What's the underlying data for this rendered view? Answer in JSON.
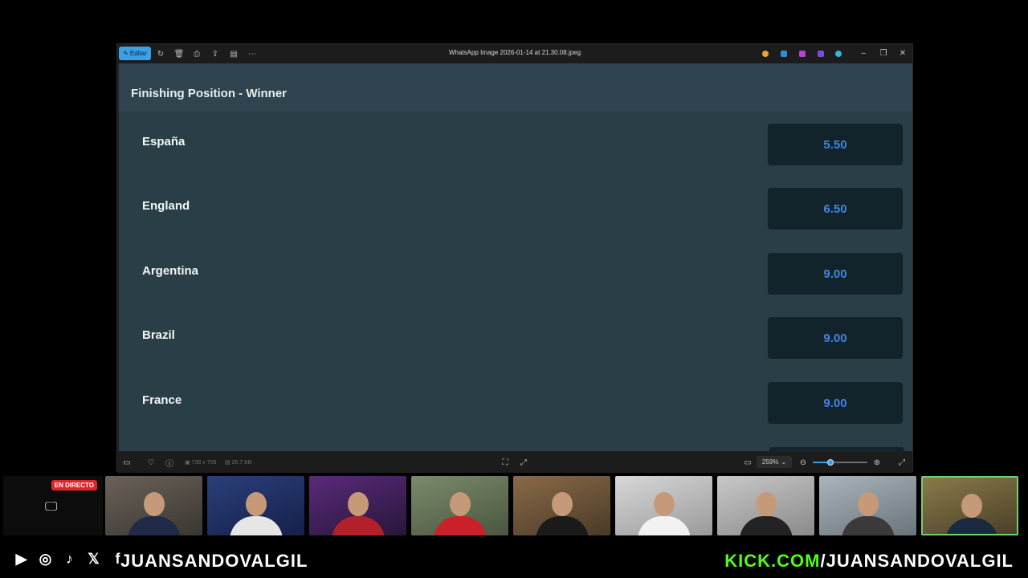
{
  "viewer": {
    "edit_label": "Editar",
    "file_name": "WhatsApp Image 2026-01-14 at 21.30.08.jpeg",
    "dimensions": "738 x 709",
    "file_size": "26.7 KB",
    "zoom": "259%"
  },
  "market": {
    "title": "Finishing Position - Winner",
    "rows": [
      {
        "team": "España",
        "odds": "5.50"
      },
      {
        "team": "England",
        "odds": "6.50"
      },
      {
        "team": "Argentina",
        "odds": "9.00"
      },
      {
        "team": "Brazil",
        "odds": "9.00"
      },
      {
        "team": "France",
        "odds": "9.00"
      }
    ]
  },
  "stream": {
    "live_label": "EN DIRECTO",
    "handle": "JUANSANDOVALGIL",
    "kick_prefix": "KICK.COM",
    "kick_suffix": "/JUANSANDOVALGIL",
    "social_icons": [
      "youtube-icon",
      "instagram-icon",
      "tiktok-icon",
      "x-icon",
      "facebook-icon"
    ]
  },
  "colors": {
    "odds_text": "#3f86e0",
    "live_badge": "#e0242b",
    "kick_green": "#53fc18",
    "accent": "#3ba0e6"
  }
}
